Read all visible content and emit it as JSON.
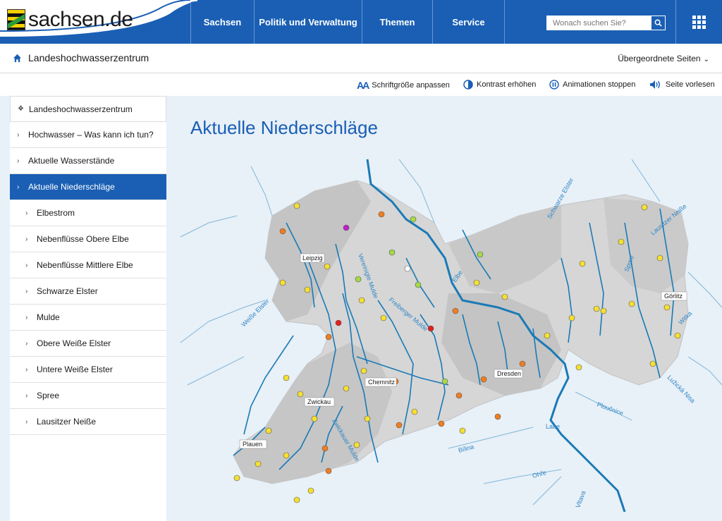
{
  "header": {
    "logo_text": "sachsen.de",
    "nav": [
      {
        "label": "Sachsen"
      },
      {
        "label": "Politik und Verwaltung"
      },
      {
        "label": "Themen"
      },
      {
        "label": "Service"
      }
    ],
    "search_placeholder": "Wonach suchen Sie?"
  },
  "breadcrumb": {
    "title": "Landeshochwasserzentrum",
    "parent_label": "Übergeordnete Seiten"
  },
  "tools": {
    "font_size": "Schriftgröße anpassen",
    "contrast": "Kontrast erhöhen",
    "animations": "Animationen stoppen",
    "read_aloud": "Seite vorlesen"
  },
  "sidebar": {
    "items": [
      {
        "label": "Landeshochwasserzentrum"
      },
      {
        "label": "Hochwasser – Was kann ich tun?"
      },
      {
        "label": "Aktuelle Wasserstände"
      },
      {
        "label": "Aktuelle Niederschläge"
      },
      {
        "label": "Elbestrom"
      },
      {
        "label": "Nebenflüsse Obere Elbe"
      },
      {
        "label": "Nebenflüsse Mittlere Elbe"
      },
      {
        "label": "Schwarze Elster"
      },
      {
        "label": "Mulde"
      },
      {
        "label": "Obere Weiße Elster"
      },
      {
        "label": "Untere Weiße Elster"
      },
      {
        "label": "Spree"
      },
      {
        "label": "Lausitzer Neiße"
      }
    ]
  },
  "main": {
    "title": "Aktuelle Niederschläge"
  },
  "map": {
    "cities": [
      "Leipzig",
      "Dresden",
      "Chemnitz",
      "Zwickau",
      "Plauen",
      "Görlitz"
    ],
    "rivers": [
      "Elbe",
      "Labe",
      "Weiße Elster",
      "Zwickauer Mulde",
      "Freiberger Mulde",
      "Spree",
      "Lausitzer Neiße",
      "Bílina",
      "Ohře",
      "Ploučnice",
      "Lužická Nisa",
      "Vltava",
      "Witka",
      "Schwarze Elster",
      "Vereinigte Mulde"
    ],
    "colors": {
      "water": "#1a7ab5",
      "land": "#d6d6d6",
      "yellow": "#f5e032",
      "orange": "#ef7d22",
      "green": "#a6d84a",
      "red": "#e02020",
      "purple": "#c020c8"
    }
  }
}
